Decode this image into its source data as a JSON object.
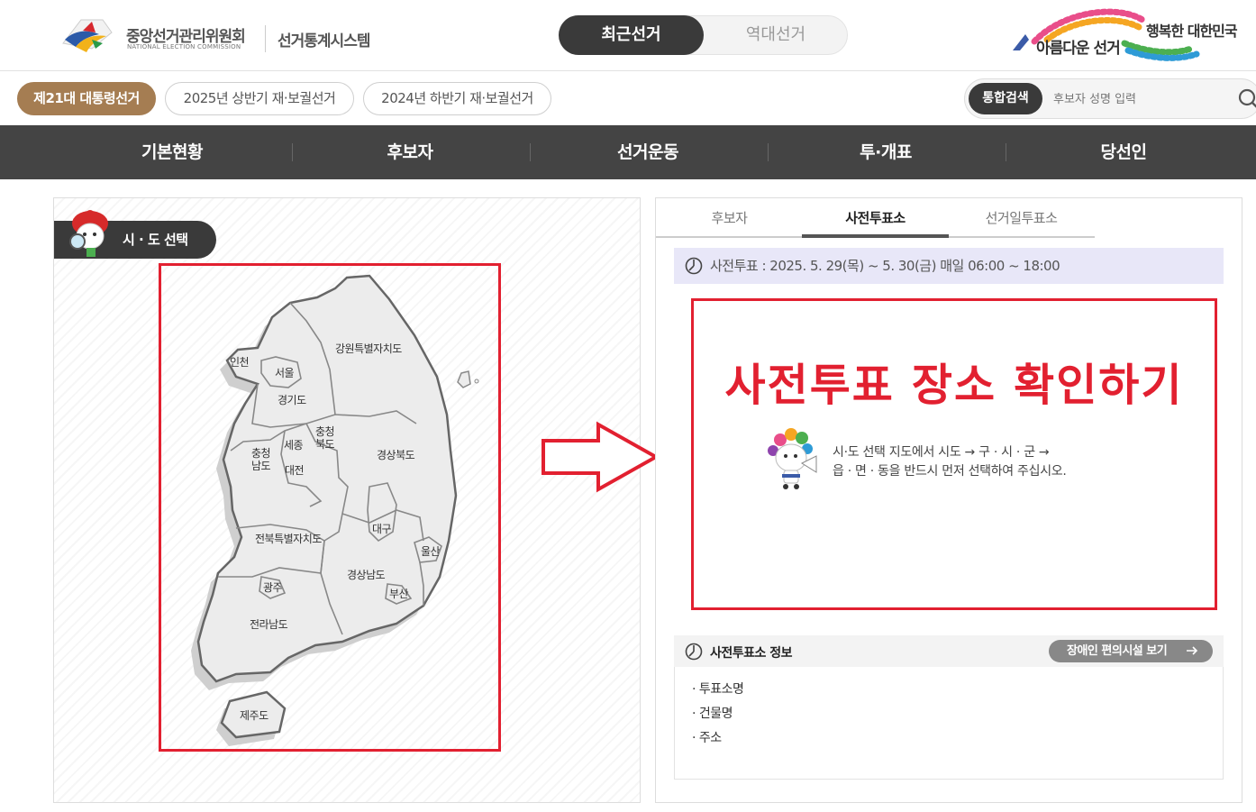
{
  "header": {
    "org_name": "중앙선거관리위원회",
    "org_eng": "NATIONAL ELECTION COMMISSION",
    "system_name": "선거통계시스템",
    "toggle": {
      "recent": "최근선거",
      "history": "역대선거"
    },
    "slogan_main": "아름다운 선거",
    "slogan_sub": "행복한 대한민국"
  },
  "election_tabs": [
    {
      "label": "제21대 대통령선거",
      "active": true
    },
    {
      "label": "2025년 상반기 재·보궐선거",
      "active": false
    },
    {
      "label": "2024년 하반기 재·보궐선거",
      "active": false
    }
  ],
  "search": {
    "button": "통합검색",
    "placeholder": "후보자 성명 입력"
  },
  "nav": [
    "기본현황",
    "후보자",
    "선거운동",
    "투·개표",
    "당선인"
  ],
  "left": {
    "tab_label": "시 · 도 선택",
    "regions": {
      "incheon": "인천",
      "seoul": "서울",
      "gyeonggi": "경기도",
      "gangwon": "강원특별자치도",
      "chungbuk": "충청\n북도",
      "chungnam": "충청\n남도",
      "sejong": "세종",
      "daejeon": "대전",
      "gyeongbuk": "경상북도",
      "daegu": "대구",
      "jeonbuk": "전북특별자치도",
      "ulsan": "울산",
      "gwangju": "광주",
      "gyeongnam": "경상남도",
      "busan": "부산",
      "jeonnam": "전라남도",
      "jeju": "제주도"
    }
  },
  "right": {
    "tabs": [
      {
        "label": "후보자",
        "active": false
      },
      {
        "label": "사전투표소",
        "active": true
      },
      {
        "label": "선거일투표소",
        "active": false
      }
    ],
    "notice": "사전투표 : 2025. 5. 29(목) ~ 5. 30(금) 매일 06:00 ~ 18:00",
    "big_title": "사전투표 장소 확인하기",
    "guide_line1": "시·도 선택 지도에서 시도 → 구 · 시 · 군 →",
    "guide_line2": "읍 · 면 · 동을 반드시 먼저 선택하여 주십시오.",
    "info_title": "사전투표소 정보",
    "facility_button": "장애인 편의시설 보기",
    "info_items": [
      "투표소명",
      "건물명",
      "주소"
    ]
  },
  "colors": {
    "accent_red": "#e22030",
    "brown": "#a57d52",
    "dark": "#3a3a3a",
    "notice_bg": "#e8e7f8"
  }
}
